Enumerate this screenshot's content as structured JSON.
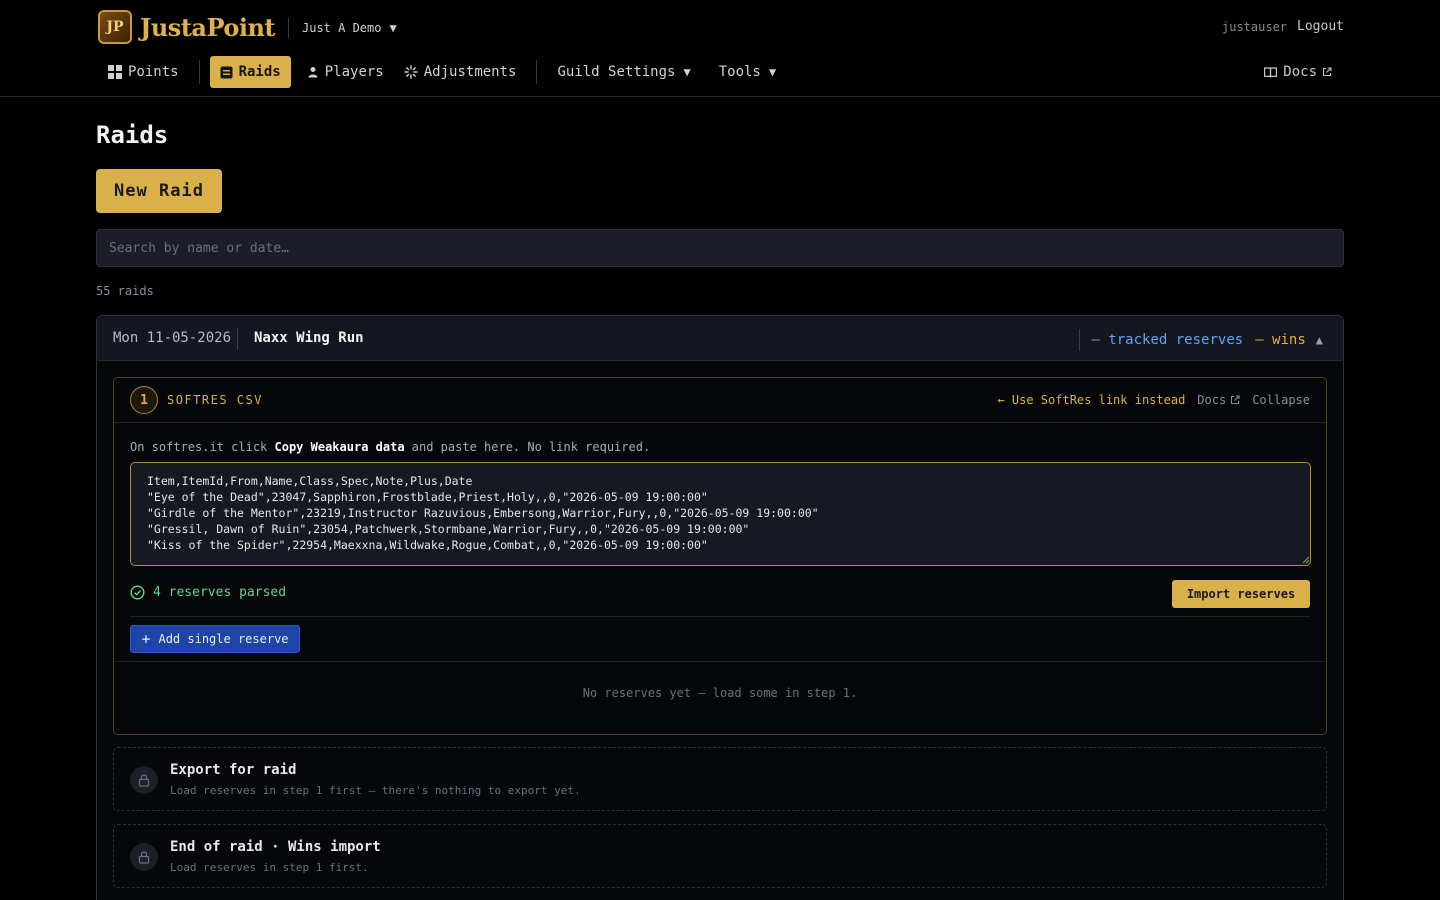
{
  "app": {
    "name": "JustaPoint",
    "logo_glyph": "JP",
    "guild_selector": "Just A Demo",
    "user": {
      "name": "justauser",
      "logout_label": "Logout"
    }
  },
  "nav": {
    "items": [
      {
        "label": "Points",
        "icon": "grid-icon",
        "active": false
      },
      {
        "label": "Raids",
        "icon": "raid-icon",
        "active": true
      },
      {
        "label": "Players",
        "icon": "user-icon",
        "active": false
      },
      {
        "label": "Adjustments",
        "icon": "sparkle-icon",
        "active": false
      },
      {
        "label": "Guild Settings",
        "icon": "chevron-down-icon",
        "active": false
      },
      {
        "label": "Tools",
        "icon": "chevron-down-icon",
        "active": false
      }
    ],
    "docs_label": "Docs"
  },
  "page": {
    "title": "Raids",
    "new_raid_label": "New Raid",
    "search_placeholder": "Search by name or date…",
    "count_text": "55 raids"
  },
  "raid": {
    "date": "Mon 11-05-2026",
    "name": "Naxx Wing Run",
    "tracked_text": "— tracked reserves",
    "wins_text": "— wins",
    "step1": {
      "number": "1",
      "title": "SOFTRES CSV",
      "use_link_label": "← Use SoftRes link instead",
      "docs_label": "Docs",
      "collapse_label": "Collapse",
      "instruction_pre": "On softres.it click ",
      "instruction_bold": "Copy Weakaura data",
      "instruction_post": " and paste here. No link required.",
      "csv_text": "Item,ItemId,From,Name,Class,Spec,Note,Plus,Date\n\"Eye of the Dead\",23047,Sapphiron,Frostblade,Priest,Holy,,0,\"2026-05-09 19:00:00\"\n\"Girdle of the Mentor\",23219,Instructor Razuvious,Embersong,Warrior,Fury,,0,\"2026-05-09 19:00:00\"\n\"Gressil, Dawn of Ruin\",23054,Patchwerk,Stormbane,Warrior,Fury,,0,\"2026-05-09 19:00:00\"\n\"Kiss of the Spider\",22954,Maexxna,Wildwake,Rogue,Combat,,0,\"2026-05-09 19:00:00\"",
      "parsed_text": "4 reserves parsed",
      "import_label": "Import reserves",
      "add_label": "Add single reserve",
      "empty_text": "No reserves yet — load some in step 1."
    },
    "export_step": {
      "title": "Export for raid",
      "subtitle": "Load reserves in step 1 first — there's nothing to export yet."
    },
    "end_step": {
      "title": "End of raid · Wins import",
      "subtitle": "Load reserves in step 1 first."
    }
  },
  "colors": {
    "accent": "#d9b04a",
    "background": "#000000",
    "tracked": "#5aa7f5",
    "success": "#68d391",
    "add_button": "#1f44a8"
  }
}
